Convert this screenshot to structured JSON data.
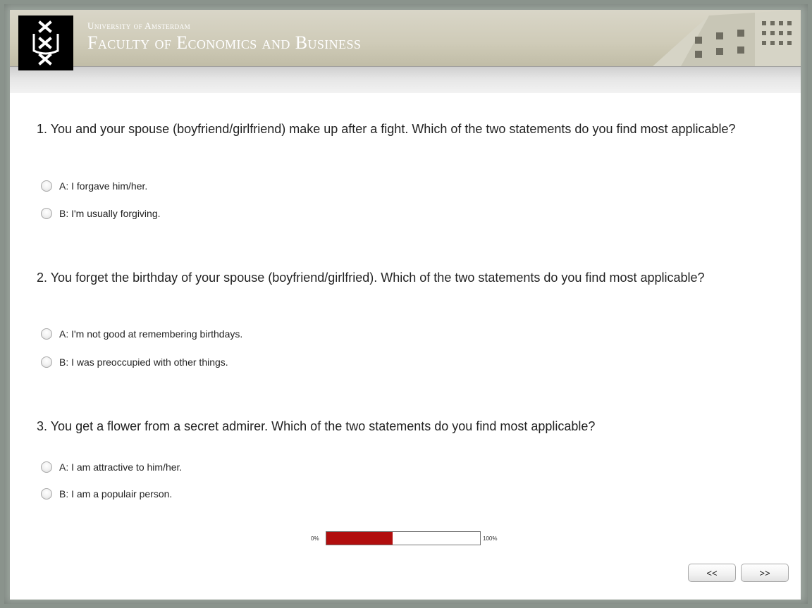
{
  "header": {
    "university": "University of Amsterdam",
    "faculty": "Faculty of Economics and Business",
    "logo_icon": "uva-logo-icon"
  },
  "questions": [
    {
      "text": "1. You and your spouse (boyfriend/girlfriend) make up after a fight. Which of the two statements do you find most applicable?",
      "options": [
        "A: I forgave him/her.",
        "B: I'm usually forgiving."
      ]
    },
    {
      "text": "2. You forget the birthday of your spouse (boyfriend/girlfried). Which of the two statements do you find most applicable?",
      "options": [
        "A: I'm not good at remembering birthdays.",
        "B: I was preoccupied with other things."
      ]
    },
    {
      "text": "3. You get a flower from a secret admirer. Which of the two statements do you find most applicable?",
      "options": [
        "A: I am attractive to him/her.",
        "B: I am a populair person."
      ]
    }
  ],
  "progress": {
    "min_label": "0%",
    "max_label": "100%",
    "value_percent": 43,
    "fill_color": "#b10e0e"
  },
  "nav": {
    "back_label": "<<",
    "next_label": ">>"
  }
}
